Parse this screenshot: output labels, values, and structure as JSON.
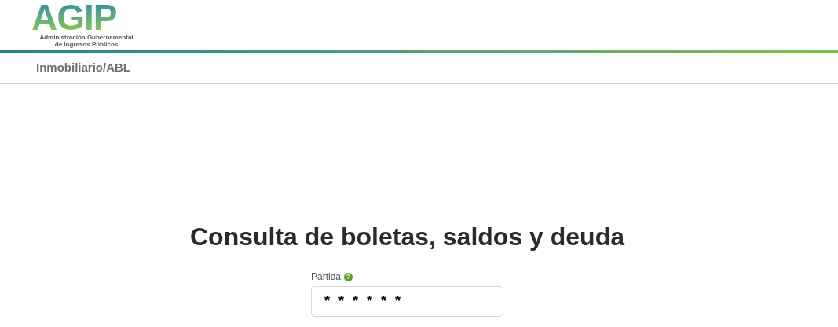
{
  "logo": {
    "wordmark": "AGIP",
    "subtitle_line_1": "Administración Gubernamental",
    "subtitle_line_2": "de Ingresos Públicos"
  },
  "breadcrumb": "Inmobiliario/ABL",
  "title": "Consulta de boletas, saldos y deuda",
  "field": {
    "label": "Partida",
    "help_icon": "?",
    "value": "* * * * * *"
  }
}
